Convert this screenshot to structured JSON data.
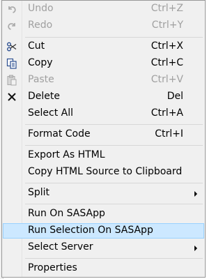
{
  "menu": {
    "items": [
      {
        "label": "Undo",
        "shortcut": "Ctrl+Z",
        "icon": "undo-icon",
        "enabled": false
      },
      {
        "label": "Redo",
        "shortcut": "Ctrl+Y",
        "icon": "redo-icon",
        "enabled": false
      },
      {
        "label": "Cut",
        "shortcut": "Ctrl+X",
        "icon": "scissors-icon",
        "enabled": true
      },
      {
        "label": "Copy",
        "shortcut": "Ctrl+C",
        "icon": "copy-icon",
        "enabled": true
      },
      {
        "label": "Paste",
        "shortcut": "Ctrl+V",
        "icon": "paste-icon",
        "enabled": false
      },
      {
        "label": "Delete",
        "shortcut": "Del",
        "icon": "delete-x-icon",
        "enabled": true
      },
      {
        "label": "Select All",
        "shortcut": "Ctrl+A",
        "enabled": true
      },
      {
        "label": "Format Code",
        "shortcut": "Ctrl+I",
        "enabled": true
      },
      {
        "label": "Export As HTML",
        "enabled": true
      },
      {
        "label": "Copy HTML Source to Clipboard",
        "enabled": true
      },
      {
        "label": "Split",
        "submenu": true,
        "enabled": true
      },
      {
        "label": "Run On SASApp",
        "enabled": true
      },
      {
        "label": "Run Selection On SASApp",
        "enabled": true,
        "highlighted": true
      },
      {
        "label": "Select Server",
        "submenu": true,
        "enabled": true
      },
      {
        "label": "Properties",
        "enabled": true
      }
    ]
  },
  "colors": {
    "menu_bg": "#f0f0f0",
    "highlight_bg": "#cce8ff",
    "highlight_border": "#99d1ff",
    "disabled_text": "#a0a0a0"
  }
}
